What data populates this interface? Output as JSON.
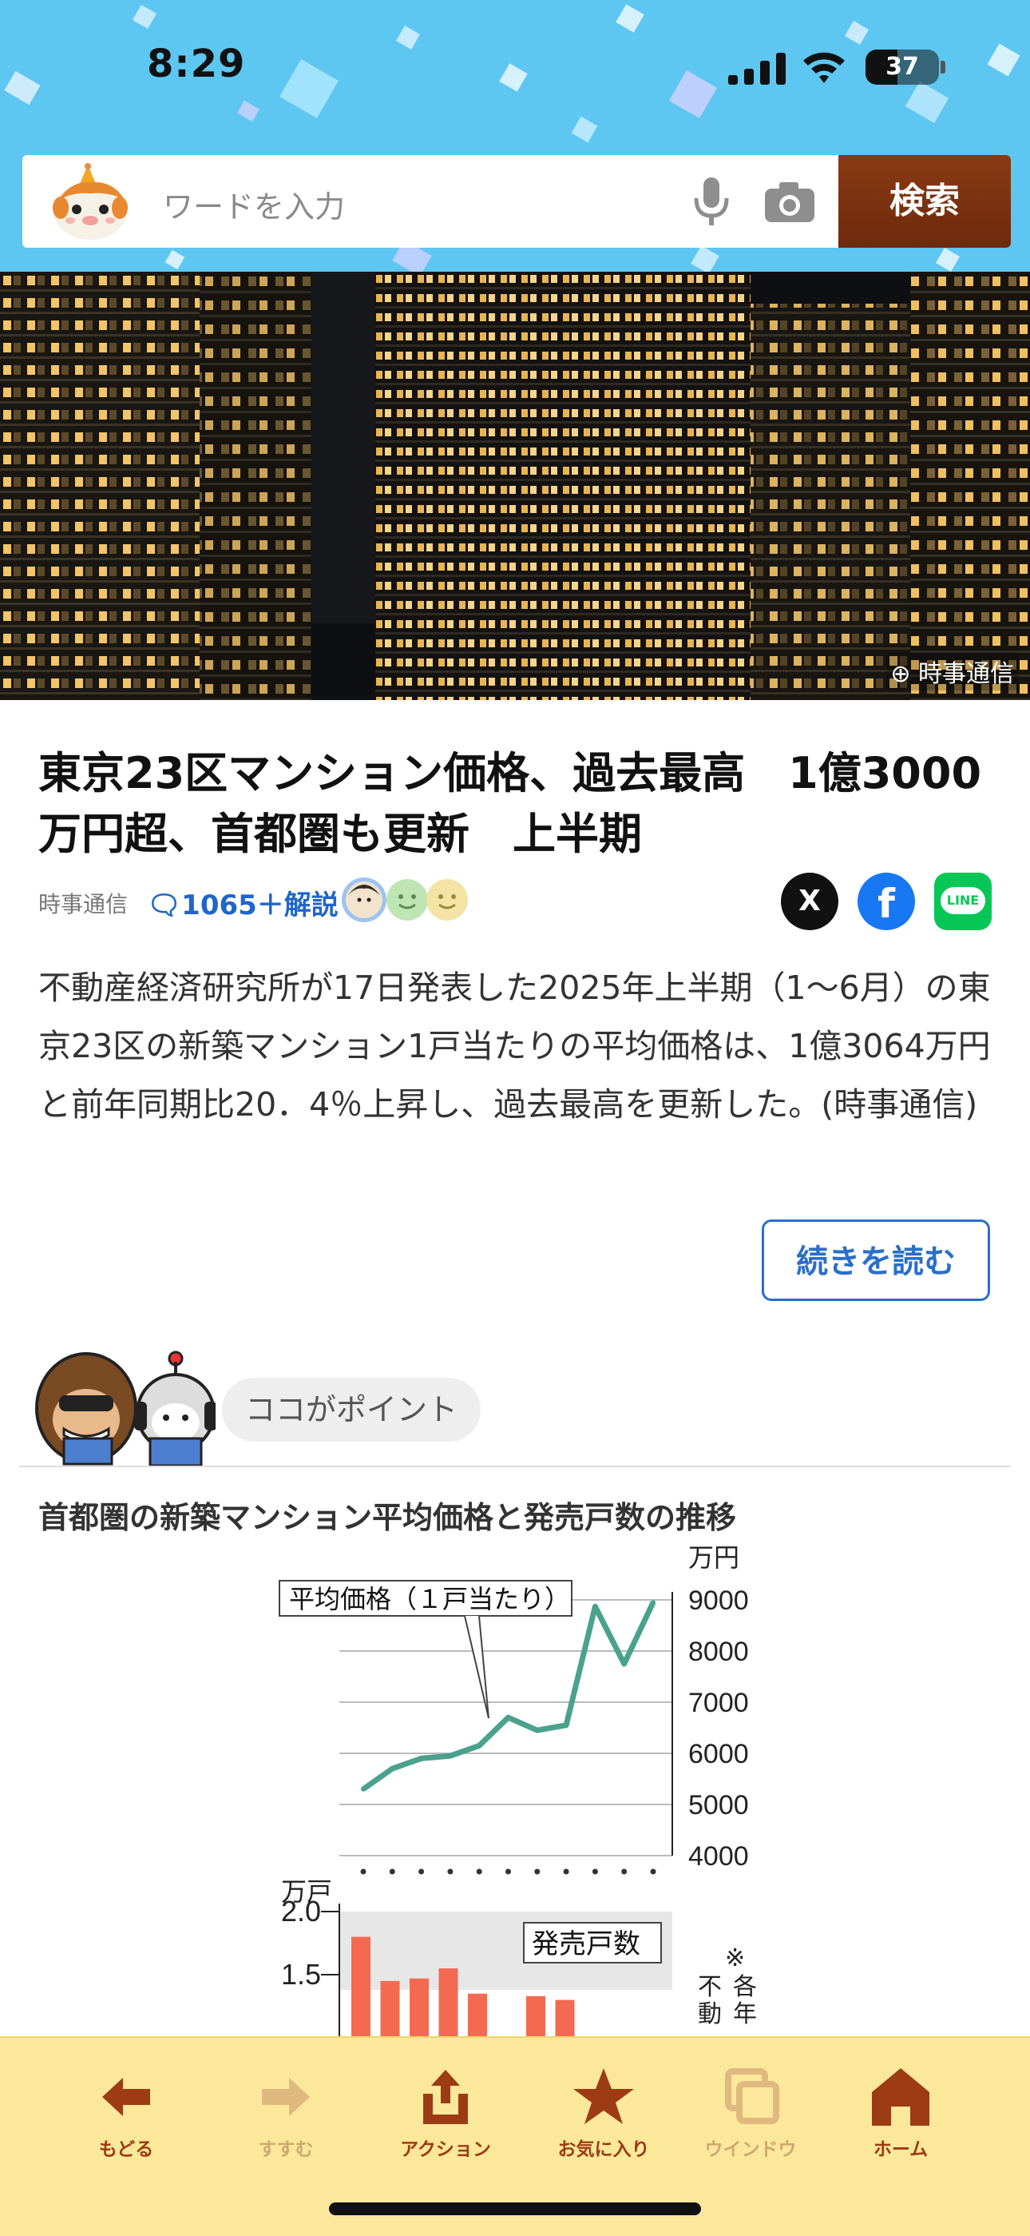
{
  "status_bar": {
    "time": "8:29",
    "battery": "37"
  },
  "search": {
    "placeholder": "ワードを入力",
    "button_label": "検索"
  },
  "hero": {
    "photo_credit": "時事通信"
  },
  "article": {
    "title": "東京23区マンション価格、過去最高　1億3000万円超、首都圏も更新　上半期",
    "source": "時事通信",
    "comments": "1065＋解説",
    "body": "不動産経済研究所が17日発表した2025年上半期（1～6月）の東京23区の新築マンション1戸当たりの平均価格は、1億3064万円と前年同期比20．4％上昇し、過去最高を更新した。(時事通信)",
    "read_more": "続きを読む"
  },
  "share": {
    "x_label": "X",
    "facebook_label": "f",
    "line_label": "LINE"
  },
  "point": {
    "label": "ココがポイント"
  },
  "chart_section_title": "首都圏の新築マンション平均価格と発売戸数の推移",
  "chart_data": {
    "type": "line",
    "title": "首都圏の新築マンション平均価格と発売戸数の推移",
    "top": {
      "series_label": "平均価格（１戸当たり）",
      "unit": "万円",
      "yticks": [
        "9000",
        "8000",
        "7000",
        "6000",
        "5000",
        "4000"
      ],
      "ylim": [
        4000,
        9000
      ],
      "values": [
        5300,
        5700,
        5900,
        5950,
        6150,
        6700,
        6450,
        6550,
        8870,
        7750,
        8950
      ]
    },
    "bottom": {
      "type": "bar",
      "series_label": "発売戸数",
      "unit": "万戸",
      "yticks": [
        "2.0",
        "1.5"
      ],
      "ylim": [
        1.0,
        2.0
      ],
      "values": [
        1.8,
        1.45,
        1.47,
        1.55,
        1.35,
        null,
        1.33,
        1.3
      ],
      "note_fragments": [
        "※",
        "各",
        "年",
        "不",
        "動"
      ]
    }
  },
  "nav": {
    "back": "もどる",
    "forward": "すすむ",
    "action": "アクション",
    "favorite": "お気に入り",
    "window": "ウインドウ",
    "home": "ホーム"
  },
  "colors": {
    "header_bg": "#5dc7f2",
    "search_button": "#7a3210",
    "line": "#4aa28e",
    "bar": "#f46a50",
    "nav_bg": "#fbe89a",
    "nav_icon": "#9c3b14"
  }
}
